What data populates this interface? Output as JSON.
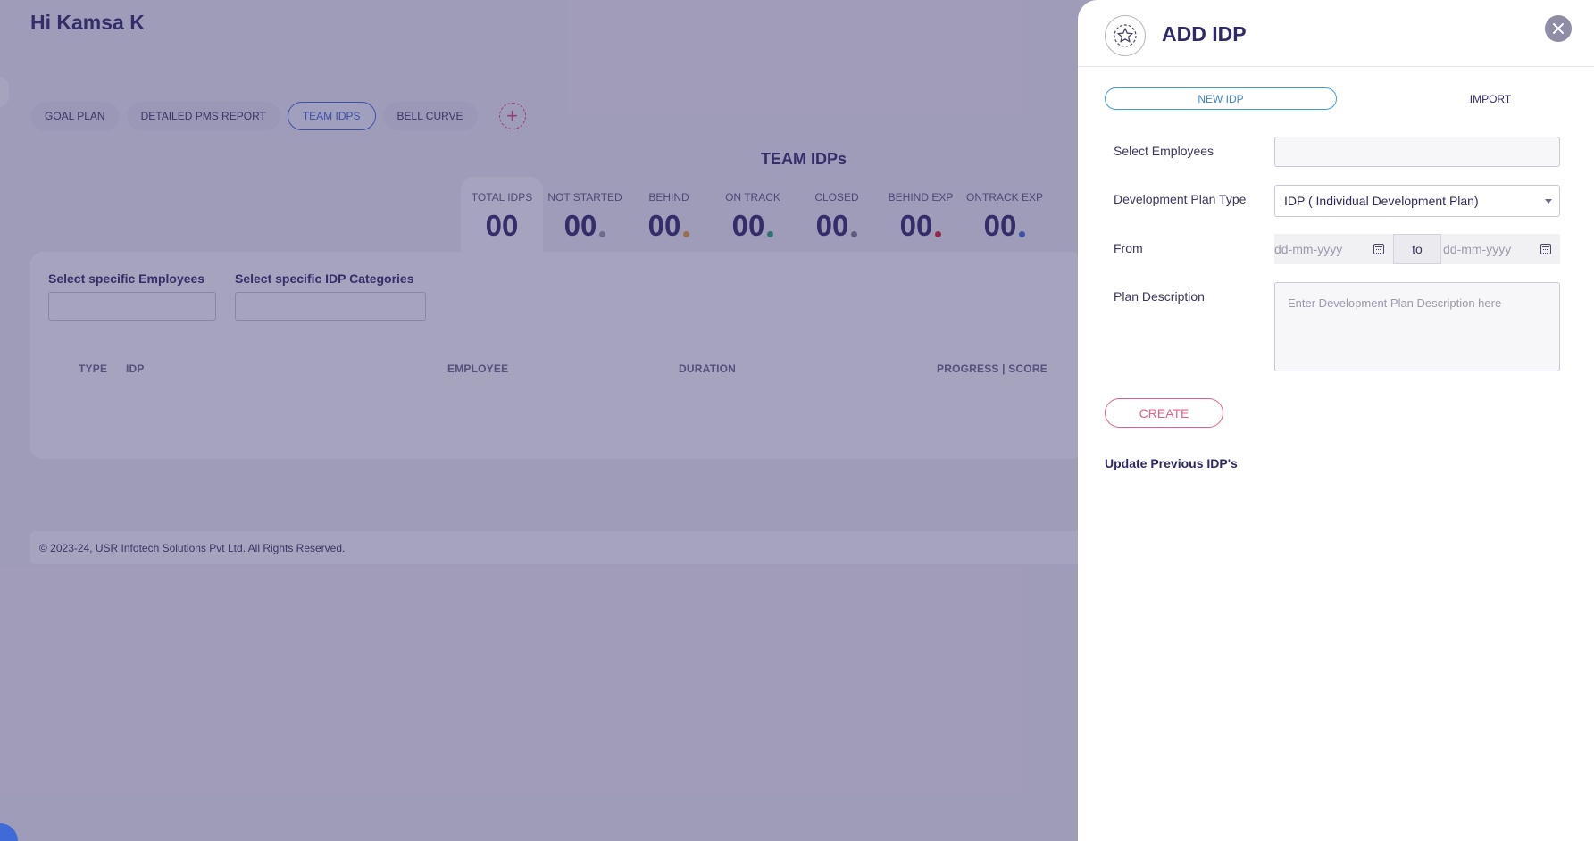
{
  "greeting": "Hi Kamsa K",
  "tabs": [
    {
      "label": "GOAL PLAN",
      "active": false
    },
    {
      "label": "DETAILED PMS REPORT",
      "active": false
    },
    {
      "label": "TEAM IDPS",
      "active": true
    },
    {
      "label": "BELL CURVE",
      "active": false
    }
  ],
  "add_tab_icon": "plus-icon",
  "section_title": "TEAM IDPs",
  "stats": [
    {
      "label": "TOTAL IDPS",
      "value": "00",
      "color": null
    },
    {
      "label": "NOT STARTED",
      "value": "00",
      "color": "#9a9aa6"
    },
    {
      "label": "BEHIND",
      "value": "00",
      "color": "#e8a13a"
    },
    {
      "label": "ON TRACK",
      "value": "00",
      "color": "#2aa872"
    },
    {
      "label": "CLOSED",
      "value": "00",
      "color": "#7b7b86"
    },
    {
      "label": "BEHIND EXP",
      "value": "00",
      "color": "#d9262e"
    },
    {
      "label": "ONTRACK EXP",
      "value": "00",
      "color": "#3f6ad8"
    }
  ],
  "filters": {
    "employees_label": "Select specific Employees",
    "categories_label": "Select specific IDP Categories"
  },
  "table": {
    "columns": [
      "TYPE",
      "IDP",
      "EMPLOYEE",
      "DURATION",
      "PROGRESS | SCORE"
    ]
  },
  "footer": "© 2023-24, USR Infotech Solutions Pvt Ltd. All Rights Reserved.",
  "drawer": {
    "title": "ADD IDP",
    "icon": "star-badge-icon",
    "close_icon": "close-icon",
    "segments": {
      "new": "NEW IDP",
      "import": "IMPORT"
    },
    "form": {
      "employees_label": "Select Employees",
      "plan_type_label": "Development Plan Type",
      "plan_type_value": "IDP ( Individual Development Plan)",
      "from_label": "From",
      "from_placeholder": "dd-mm-yyyy",
      "to_text": "to",
      "to_placeholder": "dd-mm-yyyy",
      "description_label": "Plan Description",
      "description_placeholder": "Enter Development Plan Description here"
    },
    "create_label": "CREATE",
    "update_link": "Update Previous IDP's"
  },
  "colors": {
    "accent": "#3f6ad8",
    "brand_pink": "#e75d8c",
    "overlay": "#3a336e"
  }
}
